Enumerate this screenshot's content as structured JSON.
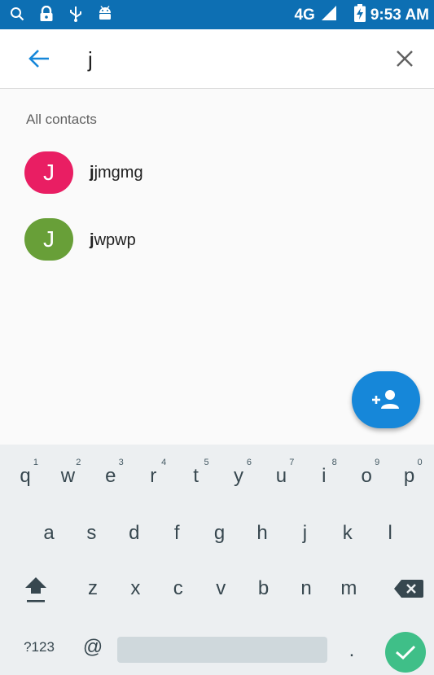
{
  "status_bar": {
    "icons": [
      "search-icon",
      "lock-icon",
      "usb-icon",
      "android-icon"
    ],
    "network": "4G",
    "time": "9:53 AM"
  },
  "search": {
    "query": "j"
  },
  "contacts": {
    "section_title": "All contacts",
    "items": [
      {
        "initial": "J",
        "match": "j",
        "rest": "jmgmg",
        "color": "#e91e63"
      },
      {
        "initial": "J",
        "match": "j",
        "rest": "wpwp",
        "color": "#689f38"
      }
    ]
  },
  "keyboard": {
    "row1": [
      {
        "key": "q",
        "hint": "1"
      },
      {
        "key": "w",
        "hint": "2"
      },
      {
        "key": "e",
        "hint": "3"
      },
      {
        "key": "r",
        "hint": "4"
      },
      {
        "key": "t",
        "hint": "5"
      },
      {
        "key": "y",
        "hint": "6"
      },
      {
        "key": "u",
        "hint": "7"
      },
      {
        "key": "i",
        "hint": "8"
      },
      {
        "key": "o",
        "hint": "9"
      },
      {
        "key": "p",
        "hint": "0"
      }
    ],
    "row2": [
      "a",
      "s",
      "d",
      "f",
      "g",
      "h",
      "j",
      "k",
      "l"
    ],
    "row3": [
      "z",
      "x",
      "c",
      "v",
      "b",
      "n",
      "m"
    ],
    "symbols_label": "?123",
    "at_label": "@",
    "period_label": "."
  },
  "colors": {
    "status_bar": "#0d6fb3",
    "accent": "#1687d9",
    "enter_key": "#3fbf88"
  }
}
